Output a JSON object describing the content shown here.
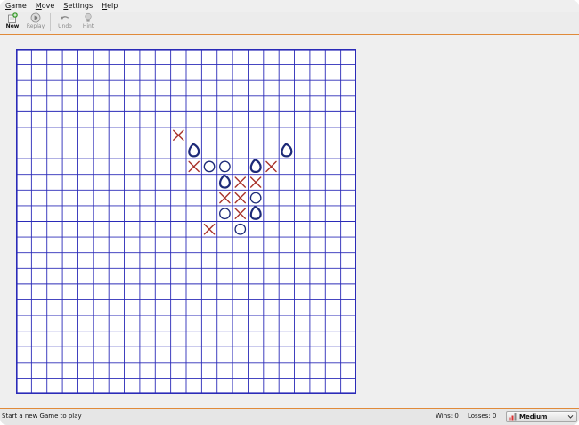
{
  "menubar": {
    "items": [
      {
        "label": "Game"
      },
      {
        "label": "Move"
      },
      {
        "label": "Settings"
      },
      {
        "label": "Help"
      }
    ]
  },
  "toolbar": {
    "new_label": "New",
    "replay_label": "Replay",
    "undo_label": "Undo",
    "hint_label": "Hint"
  },
  "board": {
    "rows": 22,
    "cols": 22,
    "grid_color": "#2b2bb8",
    "x_color": "#a8322a",
    "o_color": "#1d2a78",
    "pieces": [
      {
        "r": 5,
        "c": 10,
        "t": "X"
      },
      {
        "r": 6,
        "c": 11,
        "t": "O",
        "last": true
      },
      {
        "r": 6,
        "c": 17,
        "t": "O",
        "last": true
      },
      {
        "r": 7,
        "c": 11,
        "t": "X"
      },
      {
        "r": 7,
        "c": 12,
        "t": "O"
      },
      {
        "r": 7,
        "c": 13,
        "t": "O"
      },
      {
        "r": 7,
        "c": 15,
        "t": "O",
        "last": true
      },
      {
        "r": 7,
        "c": 16,
        "t": "X"
      },
      {
        "r": 8,
        "c": 13,
        "t": "O",
        "last": true
      },
      {
        "r": 8,
        "c": 14,
        "t": "X"
      },
      {
        "r": 8,
        "c": 15,
        "t": "X"
      },
      {
        "r": 9,
        "c": 13,
        "t": "X"
      },
      {
        "r": 9,
        "c": 14,
        "t": "X"
      },
      {
        "r": 9,
        "c": 15,
        "t": "O"
      },
      {
        "r": 10,
        "c": 13,
        "t": "O"
      },
      {
        "r": 10,
        "c": 14,
        "t": "X"
      },
      {
        "r": 10,
        "c": 15,
        "t": "O",
        "last": true
      },
      {
        "r": 11,
        "c": 12,
        "t": "X"
      },
      {
        "r": 11,
        "c": 14,
        "t": "O"
      }
    ]
  },
  "status": {
    "message": "Start a new Game to play",
    "wins": "Wins: 0",
    "losses": "Losses: 0",
    "difficulty": "Medium"
  }
}
